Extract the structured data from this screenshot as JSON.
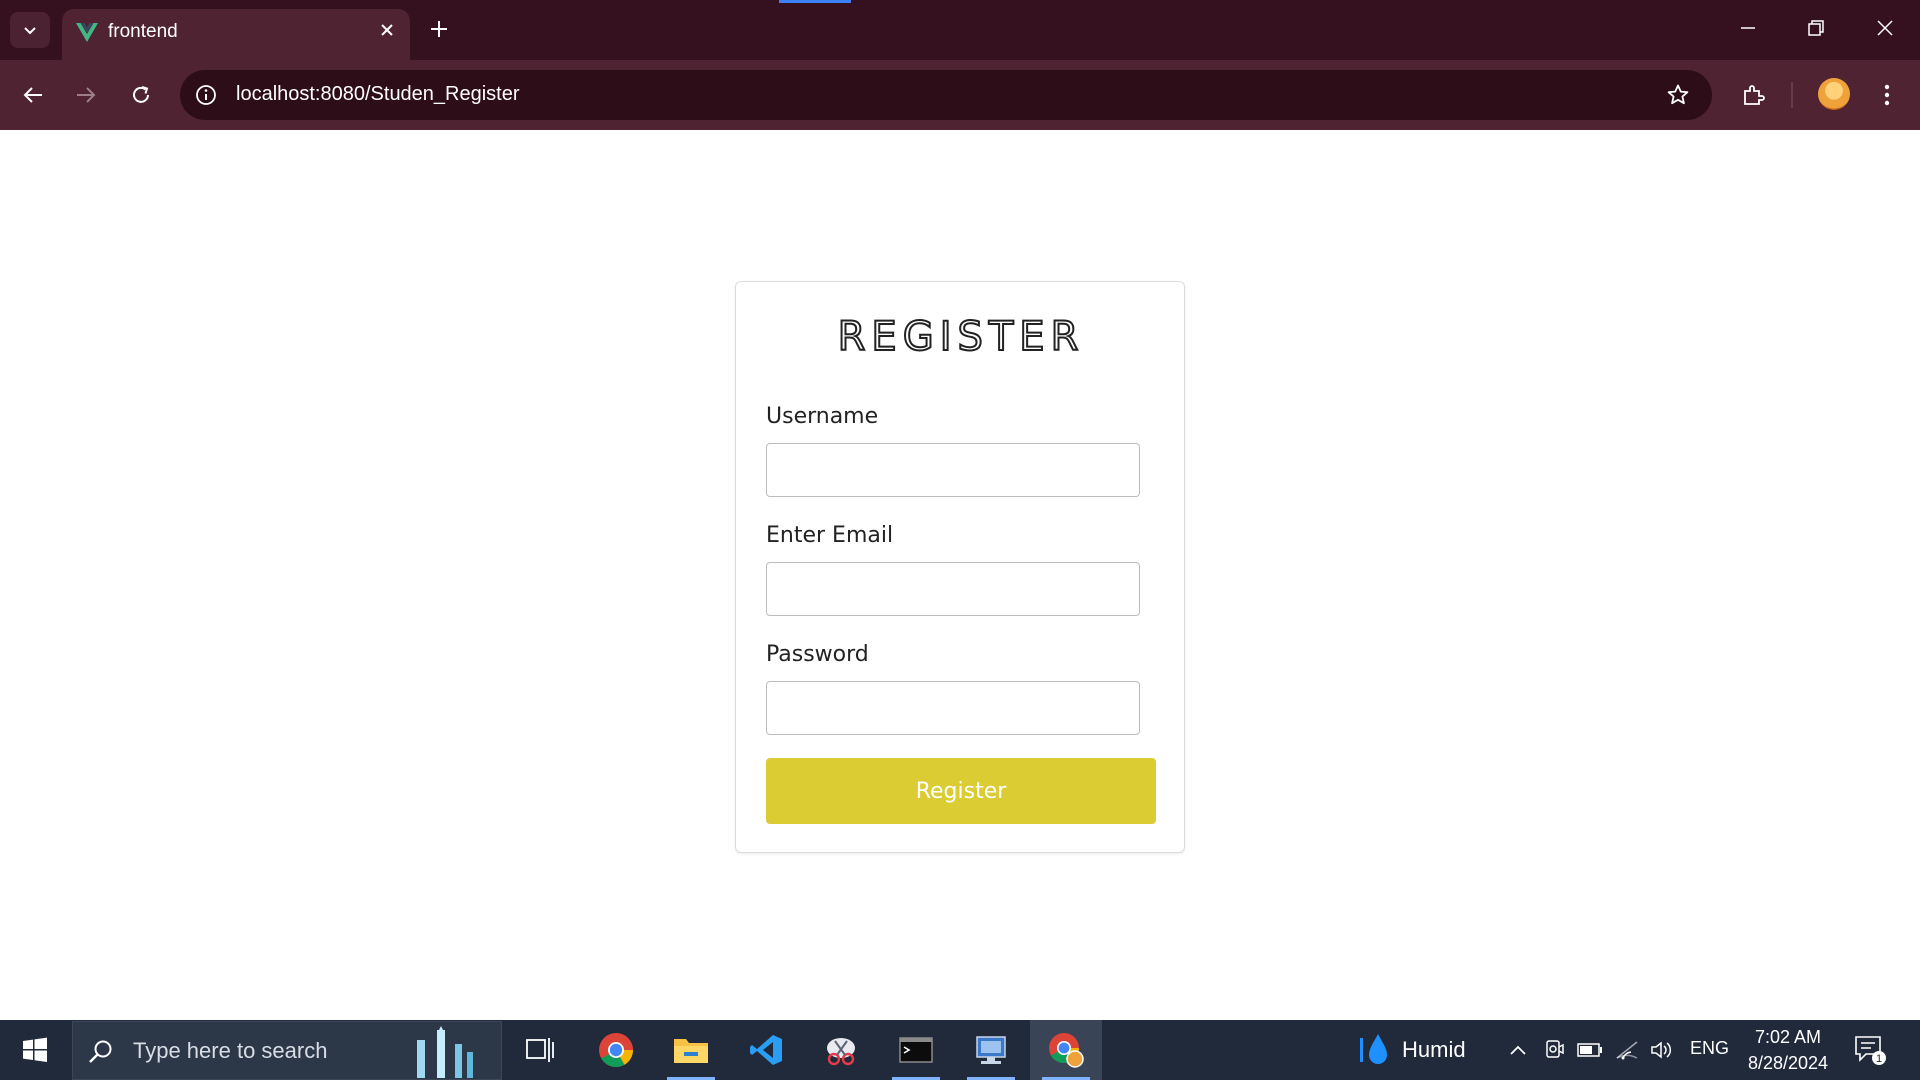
{
  "browser": {
    "tab": {
      "title": "frontend"
    },
    "address_bar": {
      "url": "localhost:8080/Studen_Register"
    }
  },
  "form": {
    "title": "REGISTER",
    "fields": [
      {
        "label": "Username",
        "value": ""
      },
      {
        "label": "Enter Email",
        "value": ""
      },
      {
        "label": "Password",
        "value": ""
      }
    ],
    "submit_label": "Register",
    "submit_color": "#dccc33"
  },
  "taskbar": {
    "search_placeholder": "Type here to search",
    "apps": [
      "task-view-icon",
      "chrome-icon",
      "file-explorer-icon",
      "vscode-icon",
      "snipping-tool-icon",
      "terminal-icon",
      "network-app-icon",
      "chrome-profile-icon"
    ],
    "weather": {
      "label": "Humid"
    },
    "language": "ENG",
    "time": "7:02 AM",
    "date": "8/28/2024",
    "notification_count": "1"
  }
}
